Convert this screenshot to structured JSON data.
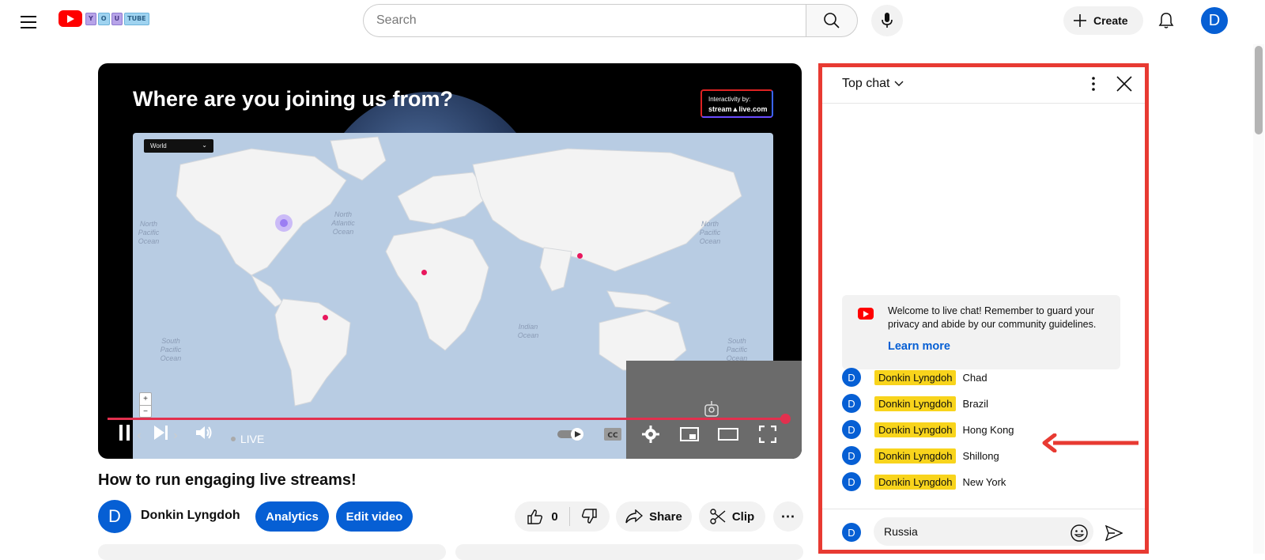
{
  "header": {
    "logo_tiles": [
      "Y",
      "O",
      "U",
      "TUBE"
    ],
    "search_placeholder": "Search",
    "create_label": "Create",
    "avatar_letter": "D"
  },
  "player": {
    "overlay_title": "Where are you joining us from?",
    "interactivity_label": "Interactivity by:",
    "interactivity_brand": "stream▲live.com",
    "map_select": "World",
    "zoom_in": "+",
    "zoom_out": "−",
    "ocean_labels": [
      "North Pacific Ocean",
      "North Atlantic Ocean",
      "North Pacific Ocean",
      "South Pacific Ocean",
      "Indian Ocean",
      "South Pacific Ocean"
    ],
    "live_label": "LIVE",
    "progress_fraction": 1.0
  },
  "video": {
    "title": "How to run engaging live streams!",
    "channel_letter": "D",
    "channel_name": "Donkin Lyngdoh",
    "analytics_label": "Analytics",
    "edit_label": "Edit video",
    "like_count": "0",
    "share_label": "Share",
    "clip_label": "Clip"
  },
  "chat": {
    "mode_label": "Top chat",
    "welcome_text": "Welcome to live chat! Remember to guard your privacy and abide by our community guidelines.",
    "learn_more": "Learn more",
    "messages": [
      {
        "avatar": "D",
        "author": "Donkin Lyngdoh",
        "text": "Chad"
      },
      {
        "avatar": "D",
        "author": "Donkin Lyngdoh",
        "text": "Brazil"
      },
      {
        "avatar": "D",
        "author": "Donkin Lyngdoh",
        "text": "Hong Kong"
      },
      {
        "avatar": "D",
        "author": "Donkin Lyngdoh",
        "text": "Shillong"
      },
      {
        "avatar": "D",
        "author": "Donkin Lyngdoh",
        "text": "New York"
      }
    ],
    "input_avatar": "D",
    "input_value": "Russia"
  },
  "colors": {
    "brand_red": "#ff0000",
    "link_blue": "#065fd4",
    "author_badge": "#f8d41c",
    "highlight_red": "#e83a32",
    "progress_red": "#e2304e"
  }
}
